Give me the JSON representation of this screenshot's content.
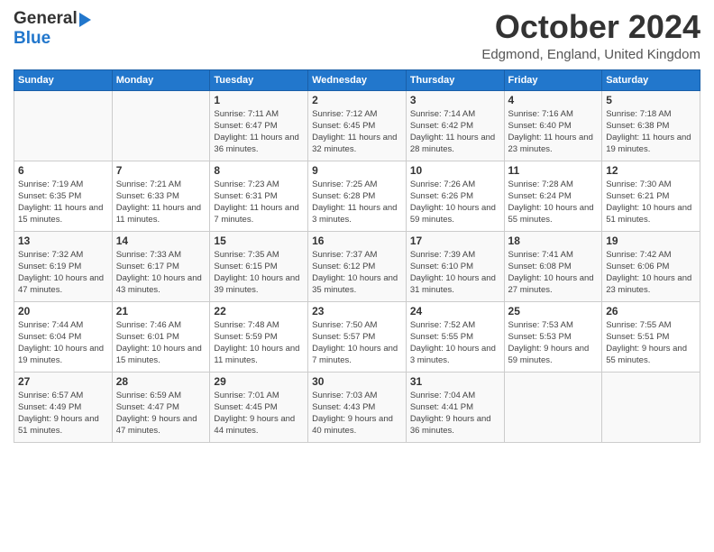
{
  "header": {
    "logo_line1": "General",
    "logo_line2": "Blue",
    "month": "October 2024",
    "location": "Edgmond, England, United Kingdom"
  },
  "columns": [
    "Sunday",
    "Monday",
    "Tuesday",
    "Wednesday",
    "Thursday",
    "Friday",
    "Saturday"
  ],
  "weeks": [
    {
      "days": [
        {
          "number": "",
          "sunrise": "",
          "sunset": "",
          "daylight": ""
        },
        {
          "number": "",
          "sunrise": "",
          "sunset": "",
          "daylight": ""
        },
        {
          "number": "1",
          "sunrise": "Sunrise: 7:11 AM",
          "sunset": "Sunset: 6:47 PM",
          "daylight": "Daylight: 11 hours and 36 minutes."
        },
        {
          "number": "2",
          "sunrise": "Sunrise: 7:12 AM",
          "sunset": "Sunset: 6:45 PM",
          "daylight": "Daylight: 11 hours and 32 minutes."
        },
        {
          "number": "3",
          "sunrise": "Sunrise: 7:14 AM",
          "sunset": "Sunset: 6:42 PM",
          "daylight": "Daylight: 11 hours and 28 minutes."
        },
        {
          "number": "4",
          "sunrise": "Sunrise: 7:16 AM",
          "sunset": "Sunset: 6:40 PM",
          "daylight": "Daylight: 11 hours and 23 minutes."
        },
        {
          "number": "5",
          "sunrise": "Sunrise: 7:18 AM",
          "sunset": "Sunset: 6:38 PM",
          "daylight": "Daylight: 11 hours and 19 minutes."
        }
      ]
    },
    {
      "days": [
        {
          "number": "6",
          "sunrise": "Sunrise: 7:19 AM",
          "sunset": "Sunset: 6:35 PM",
          "daylight": "Daylight: 11 hours and 15 minutes."
        },
        {
          "number": "7",
          "sunrise": "Sunrise: 7:21 AM",
          "sunset": "Sunset: 6:33 PM",
          "daylight": "Daylight: 11 hours and 11 minutes."
        },
        {
          "number": "8",
          "sunrise": "Sunrise: 7:23 AM",
          "sunset": "Sunset: 6:31 PM",
          "daylight": "Daylight: 11 hours and 7 minutes."
        },
        {
          "number": "9",
          "sunrise": "Sunrise: 7:25 AM",
          "sunset": "Sunset: 6:28 PM",
          "daylight": "Daylight: 11 hours and 3 minutes."
        },
        {
          "number": "10",
          "sunrise": "Sunrise: 7:26 AM",
          "sunset": "Sunset: 6:26 PM",
          "daylight": "Daylight: 10 hours and 59 minutes."
        },
        {
          "number": "11",
          "sunrise": "Sunrise: 7:28 AM",
          "sunset": "Sunset: 6:24 PM",
          "daylight": "Daylight: 10 hours and 55 minutes."
        },
        {
          "number": "12",
          "sunrise": "Sunrise: 7:30 AM",
          "sunset": "Sunset: 6:21 PM",
          "daylight": "Daylight: 10 hours and 51 minutes."
        }
      ]
    },
    {
      "days": [
        {
          "number": "13",
          "sunrise": "Sunrise: 7:32 AM",
          "sunset": "Sunset: 6:19 PM",
          "daylight": "Daylight: 10 hours and 47 minutes."
        },
        {
          "number": "14",
          "sunrise": "Sunrise: 7:33 AM",
          "sunset": "Sunset: 6:17 PM",
          "daylight": "Daylight: 10 hours and 43 minutes."
        },
        {
          "number": "15",
          "sunrise": "Sunrise: 7:35 AM",
          "sunset": "Sunset: 6:15 PM",
          "daylight": "Daylight: 10 hours and 39 minutes."
        },
        {
          "number": "16",
          "sunrise": "Sunrise: 7:37 AM",
          "sunset": "Sunset: 6:12 PM",
          "daylight": "Daylight: 10 hours and 35 minutes."
        },
        {
          "number": "17",
          "sunrise": "Sunrise: 7:39 AM",
          "sunset": "Sunset: 6:10 PM",
          "daylight": "Daylight: 10 hours and 31 minutes."
        },
        {
          "number": "18",
          "sunrise": "Sunrise: 7:41 AM",
          "sunset": "Sunset: 6:08 PM",
          "daylight": "Daylight: 10 hours and 27 minutes."
        },
        {
          "number": "19",
          "sunrise": "Sunrise: 7:42 AM",
          "sunset": "Sunset: 6:06 PM",
          "daylight": "Daylight: 10 hours and 23 minutes."
        }
      ]
    },
    {
      "days": [
        {
          "number": "20",
          "sunrise": "Sunrise: 7:44 AM",
          "sunset": "Sunset: 6:04 PM",
          "daylight": "Daylight: 10 hours and 19 minutes."
        },
        {
          "number": "21",
          "sunrise": "Sunrise: 7:46 AM",
          "sunset": "Sunset: 6:01 PM",
          "daylight": "Daylight: 10 hours and 15 minutes."
        },
        {
          "number": "22",
          "sunrise": "Sunrise: 7:48 AM",
          "sunset": "Sunset: 5:59 PM",
          "daylight": "Daylight: 10 hours and 11 minutes."
        },
        {
          "number": "23",
          "sunrise": "Sunrise: 7:50 AM",
          "sunset": "Sunset: 5:57 PM",
          "daylight": "Daylight: 10 hours and 7 minutes."
        },
        {
          "number": "24",
          "sunrise": "Sunrise: 7:52 AM",
          "sunset": "Sunset: 5:55 PM",
          "daylight": "Daylight: 10 hours and 3 minutes."
        },
        {
          "number": "25",
          "sunrise": "Sunrise: 7:53 AM",
          "sunset": "Sunset: 5:53 PM",
          "daylight": "Daylight: 9 hours and 59 minutes."
        },
        {
          "number": "26",
          "sunrise": "Sunrise: 7:55 AM",
          "sunset": "Sunset: 5:51 PM",
          "daylight": "Daylight: 9 hours and 55 minutes."
        }
      ]
    },
    {
      "days": [
        {
          "number": "27",
          "sunrise": "Sunrise: 6:57 AM",
          "sunset": "Sunset: 4:49 PM",
          "daylight": "Daylight: 9 hours and 51 minutes."
        },
        {
          "number": "28",
          "sunrise": "Sunrise: 6:59 AM",
          "sunset": "Sunset: 4:47 PM",
          "daylight": "Daylight: 9 hours and 47 minutes."
        },
        {
          "number": "29",
          "sunrise": "Sunrise: 7:01 AM",
          "sunset": "Sunset: 4:45 PM",
          "daylight": "Daylight: 9 hours and 44 minutes."
        },
        {
          "number": "30",
          "sunrise": "Sunrise: 7:03 AM",
          "sunset": "Sunset: 4:43 PM",
          "daylight": "Daylight: 9 hours and 40 minutes."
        },
        {
          "number": "31",
          "sunrise": "Sunrise: 7:04 AM",
          "sunset": "Sunset: 4:41 PM",
          "daylight": "Daylight: 9 hours and 36 minutes."
        },
        {
          "number": "",
          "sunrise": "",
          "sunset": "",
          "daylight": ""
        },
        {
          "number": "",
          "sunrise": "",
          "sunset": "",
          "daylight": ""
        }
      ]
    }
  ]
}
